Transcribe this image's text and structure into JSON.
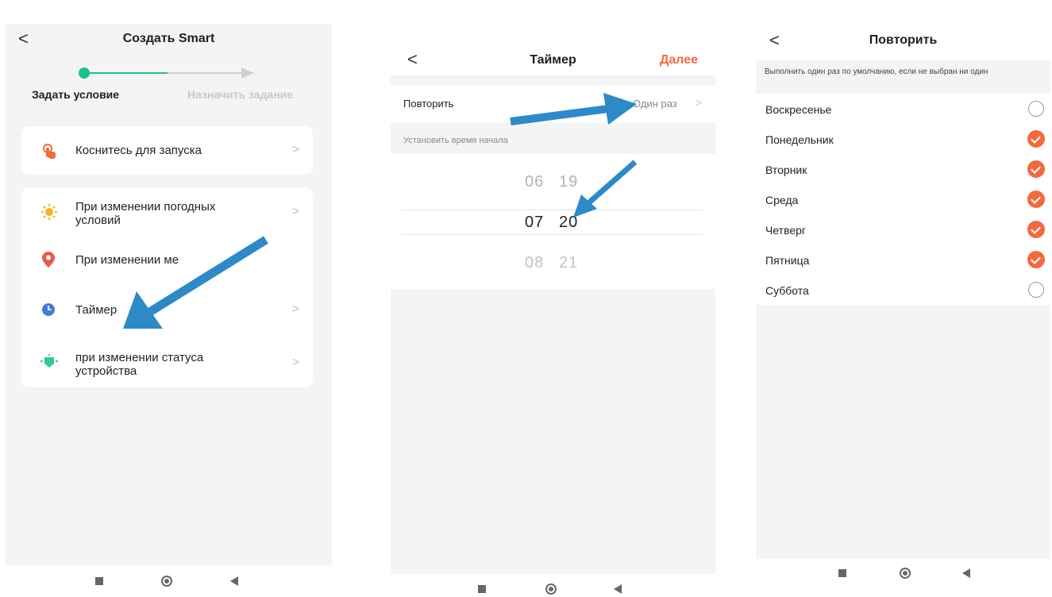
{
  "panel1": {
    "title": "Создать Smart",
    "step_active": "Задать условие",
    "step_inactive": "Назначить задание",
    "items": [
      {
        "label": "Коснитесь для запуска",
        "icon": "hand-tap-icon"
      },
      {
        "label": "При изменении погодных условий",
        "icon": "sun-icon"
      },
      {
        "label": "При изменении ме",
        "icon": "location-pin-icon"
      },
      {
        "label": "Таймер",
        "icon": "clock-icon"
      },
      {
        "label": "при изменении статуса устройства",
        "icon": "device-icon"
      }
    ],
    "chevron": ">"
  },
  "panel2": {
    "title": "Таймер",
    "next": "Далее",
    "repeat_label": "Повторить",
    "repeat_value": "Один раз",
    "section_header": "Установить время начала",
    "wheel": [
      {
        "hour": "06",
        "minute": "19"
      },
      {
        "hour": "07",
        "minute": "20"
      },
      {
        "hour": "08",
        "minute": "21"
      }
    ],
    "chevron": ">"
  },
  "panel3": {
    "title": "Повторить",
    "hint": "Выполнить один раз по умолчанию, если не выбран ни один",
    "days": [
      {
        "label": "Воскресенье",
        "checked": false
      },
      {
        "label": "Понедельник",
        "checked": true
      },
      {
        "label": "Вторник",
        "checked": true
      },
      {
        "label": "Среда",
        "checked": true
      },
      {
        "label": "Четверг",
        "checked": true
      },
      {
        "label": "Пятница",
        "checked": true
      },
      {
        "label": "Суббота",
        "checked": false
      }
    ]
  },
  "back_glyph": "<",
  "colors": {
    "accent_green": "#1ec28b",
    "accent_orange": "#f26a3c",
    "arrow_blue": "#2d8ac7",
    "screen_bg": "#f4f4f4"
  }
}
